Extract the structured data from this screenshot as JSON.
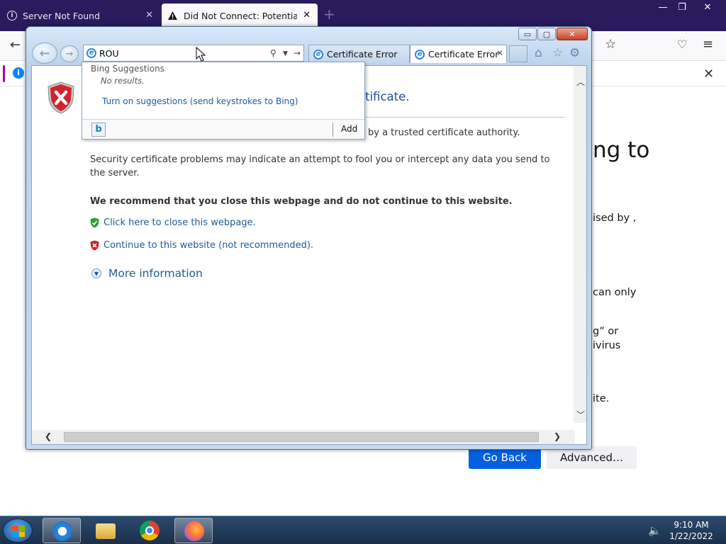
{
  "firefox": {
    "tabs": [
      {
        "title": "Server Not Found",
        "icon": "info-circle-icon",
        "active": false
      },
      {
        "title": "Did Not Connect: Potential Secu",
        "icon": "warning-icon",
        "active": true
      }
    ],
    "new_tab": "+",
    "window_controls": {
      "minimize": "—",
      "restore": "❐",
      "close": "✕"
    },
    "nav": {
      "back": "←",
      "star": "☆",
      "pocket": "♡",
      "menu": "≡"
    },
    "notification_close": "✕",
    "page": {
      "heading_fragment": "ng to",
      "text_fragments": [
        "ised by ,",
        "can only",
        "g” or",
        "ivirus",
        "ite."
      ],
      "go_back_label": "Go Back",
      "advanced_label": "Advanced…"
    }
  },
  "ie": {
    "window_controls": {
      "minimize": "▭",
      "maximize": "▢",
      "close": "✕"
    },
    "address_value": "ROU",
    "tabs": [
      {
        "title": "Certificate Error: Na...",
        "active": false
      },
      {
        "title": "Certificate Error: ...",
        "active": true
      }
    ],
    "tab_close": "✕",
    "toolbar": {
      "home": "⌂",
      "favorites": "☆",
      "tools": "⚙"
    },
    "content": {
      "title_fragment": "tificate.",
      "line1_fragment": "by a trusted certificate authority.",
      "line2": "Security certificate problems may indicate an attempt to fool you or intercept any data you send to the server.",
      "recommend": "We recommend that you close this webpage and do not continue to this website.",
      "close_link": "Click here to close this webpage.",
      "continue_link": "Continue to this website (not recommended).",
      "more_info": "More information"
    },
    "dropdown": {
      "header": "Bing Suggestions",
      "no_results": "No results.",
      "turn_on": "Turn on suggestions (send keystrokes to Bing)",
      "bing_glyph": "b",
      "add_label": "Add"
    }
  },
  "taskbar": {
    "time": "9:10 AM",
    "date": "1/22/2022"
  }
}
